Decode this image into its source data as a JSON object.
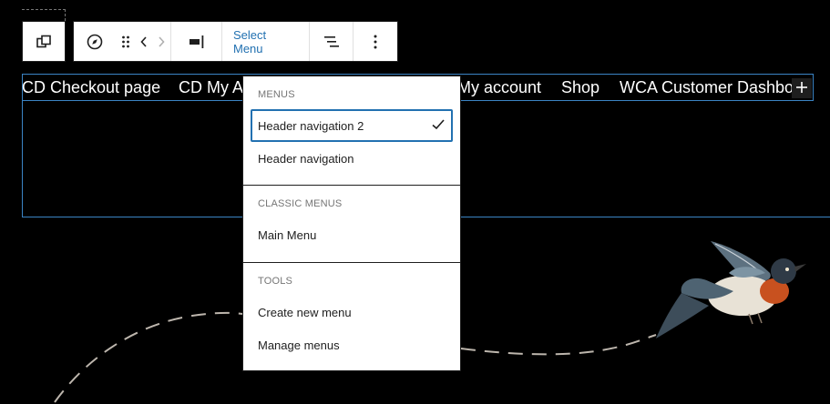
{
  "toolbar": {
    "parent_icon": "parent-block-icon",
    "navigation_icon": "compass-icon",
    "drag_icon": "drag-handle-icon",
    "move_left_icon": "chevron-left-icon",
    "move_right_icon": "chevron-right-icon",
    "justify_icon": "justify-right-icon",
    "select_menu_label": "Select Menu",
    "list_view_icon": "list-view-icon",
    "options_icon": "more-vertical-icon"
  },
  "nav": {
    "items": [
      "CD Checkout page",
      "CD My A",
      "My account",
      "Shop",
      "WCA Customer Dashboard"
    ],
    "add_icon": "plus-icon"
  },
  "dropdown": {
    "menus_heading": "Menus",
    "menus": [
      {
        "label": "Header navigation 2",
        "selected": true
      },
      {
        "label": "Header navigation",
        "selected": false
      }
    ],
    "classic_heading": "Classic Menus",
    "classic": [
      {
        "label": "Main Menu"
      }
    ],
    "tools_heading": "Tools",
    "tools": [
      {
        "label": "Create new menu"
      },
      {
        "label": "Manage menus"
      }
    ],
    "check_icon": "check-icon"
  },
  "colors": {
    "accent": "#2271b1",
    "selection_outline": "#3b84c4",
    "background": "#000000"
  }
}
